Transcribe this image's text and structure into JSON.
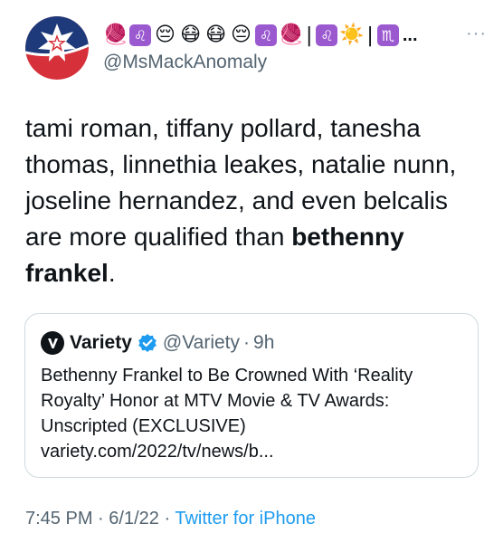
{
  "author": {
    "handle": "@MsMackAnomaly",
    "name_emojis": [
      "🧶",
      "♌",
      "😔",
      "😷",
      "😷",
      "😔",
      "♌",
      "🧶",
      "|",
      "♌",
      "☀️",
      "|",
      "♏",
      "..."
    ]
  },
  "more_menu": "···",
  "tweet": {
    "text_plain": "tami roman, tiffany pollard, tanesha thomas, linnethia leakes, natalie nunn, joseline hernandez, and even belcalis are more qualified than",
    "text_bold": "bethenny frankel",
    "text_end": "."
  },
  "quoted": {
    "name": "Variety",
    "handle": "@Variety",
    "separator": "·",
    "time": "9h",
    "text": "Bethenny Frankel to Be Crowned With ‘Reality Royalty’ Honor at MTV Movie & TV Awards: Unscripted (EXCLUSIVE) variety.com/2022/tv/news/b..."
  },
  "meta": {
    "time": "7:45 PM",
    "date": "6/1/22",
    "separator": "·",
    "source": "Twitter for iPhone"
  },
  "colors": {
    "link": "#1d9bf0",
    "secondary_text": "#536471",
    "border": "#cfd9de",
    "avatar_red": "#d6303b",
    "avatar_navy": "#1e3a7a"
  },
  "icons": {
    "avatar": "juneteenth-flag-avatar",
    "verified": "verified-badge-icon",
    "variety_logo": "variety-v-logo-icon",
    "more": "more-options-icon"
  }
}
